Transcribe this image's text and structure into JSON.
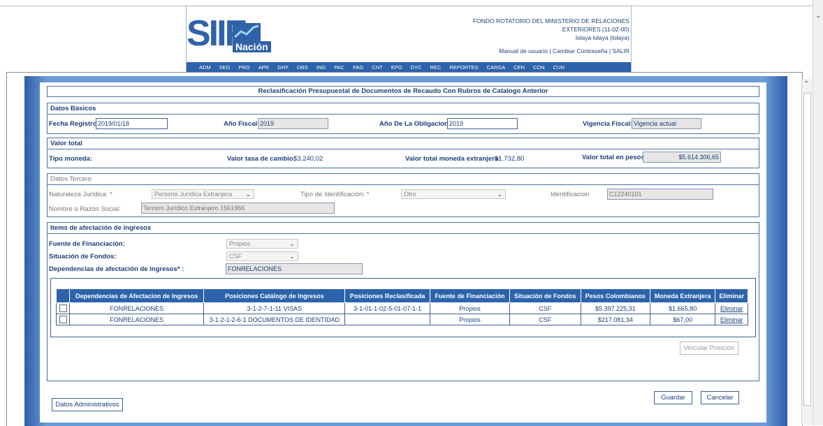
{
  "header": {
    "logo_text": "SIIF",
    "logo_sub": "Nación",
    "entity": "FONDO ROTATORIO DEL MINISTERIO DE RELACIONES",
    "entity_line2": "EXTERIORES (11-02-00)",
    "user": "lolaya lolaya (lolaya)",
    "link_manual": "Manual de usuario",
    "link_password": "Cambiar Contraseña",
    "link_exit": "SALIR",
    "sep": "|"
  },
  "menu": [
    "ADM",
    "SEG",
    "PRG",
    "APR",
    "GRF",
    "OBS",
    "ING",
    "PAC",
    "PAG",
    "CNT",
    "EPG",
    "DYC",
    "REC",
    "REPORTES",
    "CARGA",
    "CEN",
    "CON",
    "CUN"
  ],
  "form": {
    "title": "Reclasificación Presupuestal de Documentos de Recaudo Con Rubros de Catalogo Anterior",
    "basic": {
      "section": "Datos Básicos",
      "fecha_label": "Fecha Registro:",
      "fecha_value": "2019/01/18",
      "anio_label": "Año Fiscal:",
      "anio_value": "2019",
      "obligacion_label": "Año De La Obligacion:",
      "obligacion_value": "2019",
      "vigencia_label": "Vigencia Fiscal:",
      "vigencia_value": "Vigencia actual"
    },
    "total": {
      "section": "Valor total",
      "moneda_label": "Tipo moneda:",
      "tasa_label": "Valor tasa de cambio:",
      "tasa_value": "$3.240,02",
      "extranjera_label": "Valor total moneda extranjera:",
      "extranjera_value": "$1.732,80",
      "pesos_label": "Valor total en pesos",
      "pesos_value": "$5.614.306,65"
    },
    "tercero": {
      "section": "Datos Tercero",
      "naturaleza_label": "Naturaleza Jurídica: *",
      "naturaleza_value": "Persona Jurídica Extranjera",
      "tipo_id_label": "Tipo de Identificación: *",
      "tipo_id_value": "Otro",
      "identificacion_label": "Identificacion",
      "identificacion_value": "C12240101",
      "nombre_label": "Nombre o Razón Social:",
      "nombre_value": "Tercero Jurídico Extranjero 1561966"
    },
    "items": {
      "section": "Items de afectación de ingresos",
      "fuente_label": "Fuente de Financiación:",
      "fuente_value": "Propios",
      "situacion_label": "Situación de Fondos:",
      "situacion_value": "CSF",
      "dependencias_label": "Dependencias de afectación de ingresos* :",
      "dependencias_value": "FONRELACIONES",
      "columns": [
        "Dependencias de Afectacion de Ingresos",
        "Posiciones Catálogo de Ingresos",
        "Posiciones Reclasificada",
        "Fuente de Financiación",
        "Situación de Fondos",
        "Pesos Colombianos",
        "Moneda Extranjera",
        "Eliminar"
      ],
      "rows": [
        {
          "dependencia": "FONRELACIONES",
          "posicion": "3-1-2-7-1-11 VISAS",
          "reclasificada": "3-1-01-1-02-5-01-07-1-1",
          "fuente": "Propios",
          "situacion": "CSF",
          "pesos": "$5.397.225,31",
          "extranjera": "$1.665,80",
          "eliminar": "Eliminar"
        },
        {
          "dependencia": "FONRELACIONES",
          "posicion": "3-1-2-1-2-6-1 DOCUMENTOS DE IDENTIDAD",
          "reclasificada": "",
          "fuente": "Propios",
          "situacion": "CSF",
          "pesos": "$217.081,34",
          "extranjera": "$67,00",
          "eliminar": "Eliminar"
        }
      ],
      "vincular_button": "Vincular Posición"
    },
    "buttons": {
      "admin": "Datos Administrativos",
      "save": "Guardar",
      "cancel": "Cancelar"
    }
  }
}
